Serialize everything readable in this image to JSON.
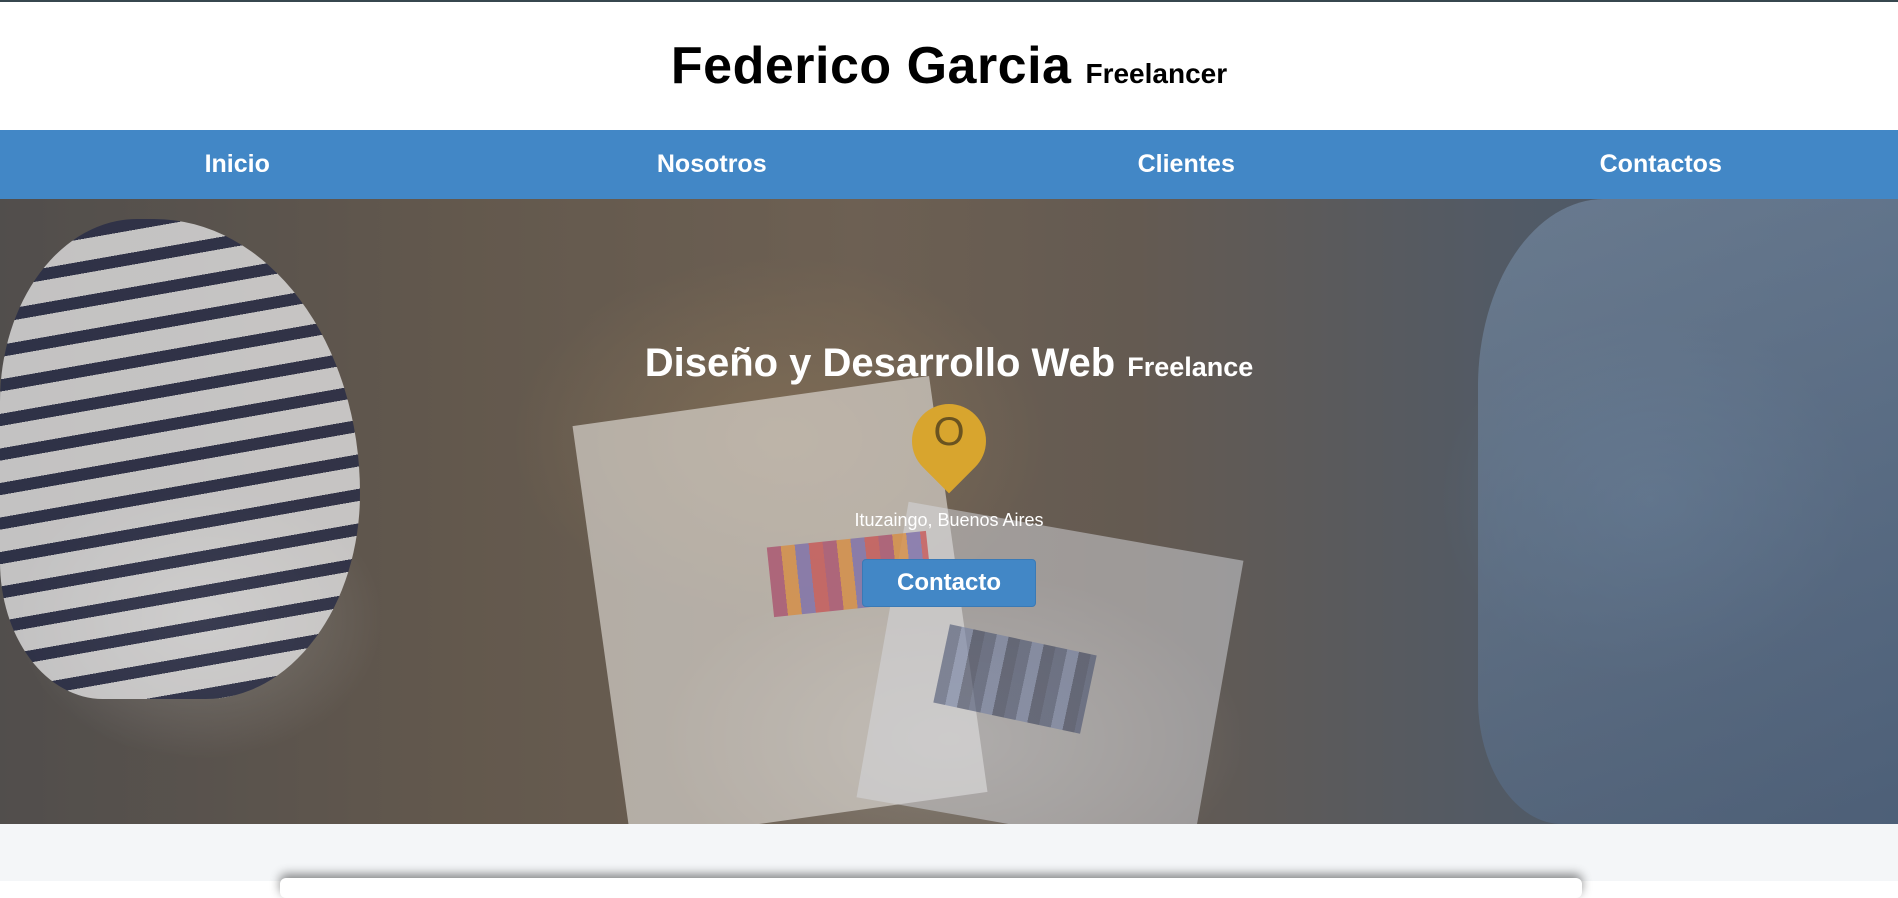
{
  "header": {
    "name": "Federico Garcia",
    "tag": "Freelancer"
  },
  "nav": {
    "items": [
      {
        "label": "Inicio"
      },
      {
        "label": "Nosotros"
      },
      {
        "label": "Clientes"
      },
      {
        "label": "Contactos"
      }
    ]
  },
  "hero": {
    "title": "Diseño y Desarrollo Web",
    "title_suffix": "Freelance",
    "pin_icon": "map-pin-icon",
    "pin_letter": "O",
    "location": "Ituzaingo, Buenos Aires",
    "cta_label": "Contacto"
  },
  "colors": {
    "accent": "#4287c6",
    "pin": "#d8a52e",
    "header_bg": "#ffffff",
    "section_bg": "#f4f6f8"
  }
}
